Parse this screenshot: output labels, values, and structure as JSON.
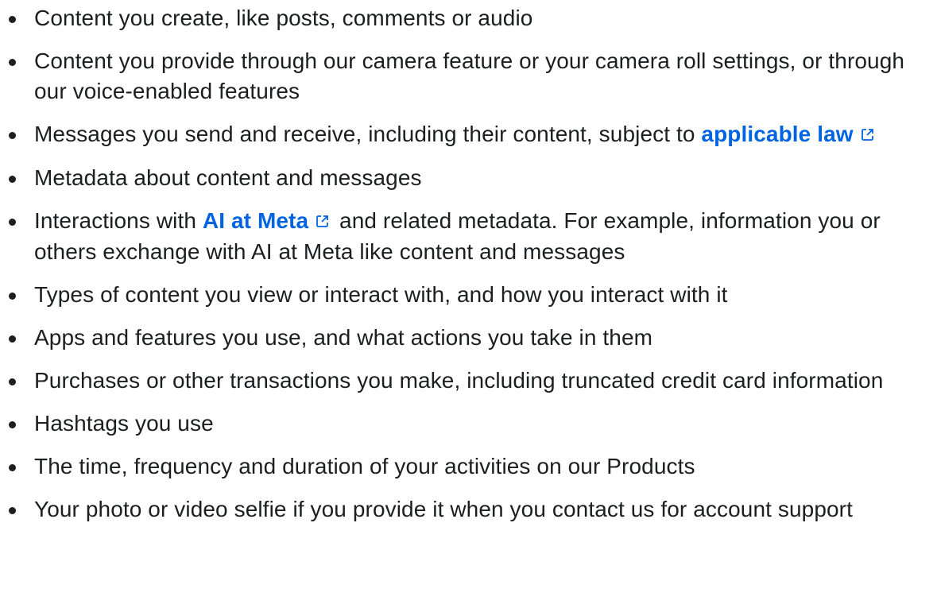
{
  "items": [
    {
      "text": "Content you create, like posts, comments or audio"
    },
    {
      "text": "Content you provide through our camera feature or your camera roll settings, or through our voice-enabled features"
    },
    {
      "before": "Messages you send and receive, including their content, subject to ",
      "link": "applicable law",
      "after": ""
    },
    {
      "text": "Metadata about content and messages"
    },
    {
      "before": "Interactions with ",
      "link": "AI at Meta",
      "after": " and related metadata. For example, information you or others exchange with AI at Meta like content and messages"
    },
    {
      "text": "Types of content you view or interact with, and how you interact with it"
    },
    {
      "text": "Apps and features you use, and what actions you take in them"
    },
    {
      "text": "Purchases or other transactions you make, including truncated credit card information"
    },
    {
      "text": "Hashtags you use"
    },
    {
      "text": "The time, frequency and duration of your activities on our Products"
    },
    {
      "text": "Your photo or video selfie if you provide it when you contact us for account support"
    }
  ],
  "colors": {
    "text": "#1c1e21",
    "link": "#0064e0"
  },
  "icons": {
    "external_link": "external-link-icon"
  }
}
